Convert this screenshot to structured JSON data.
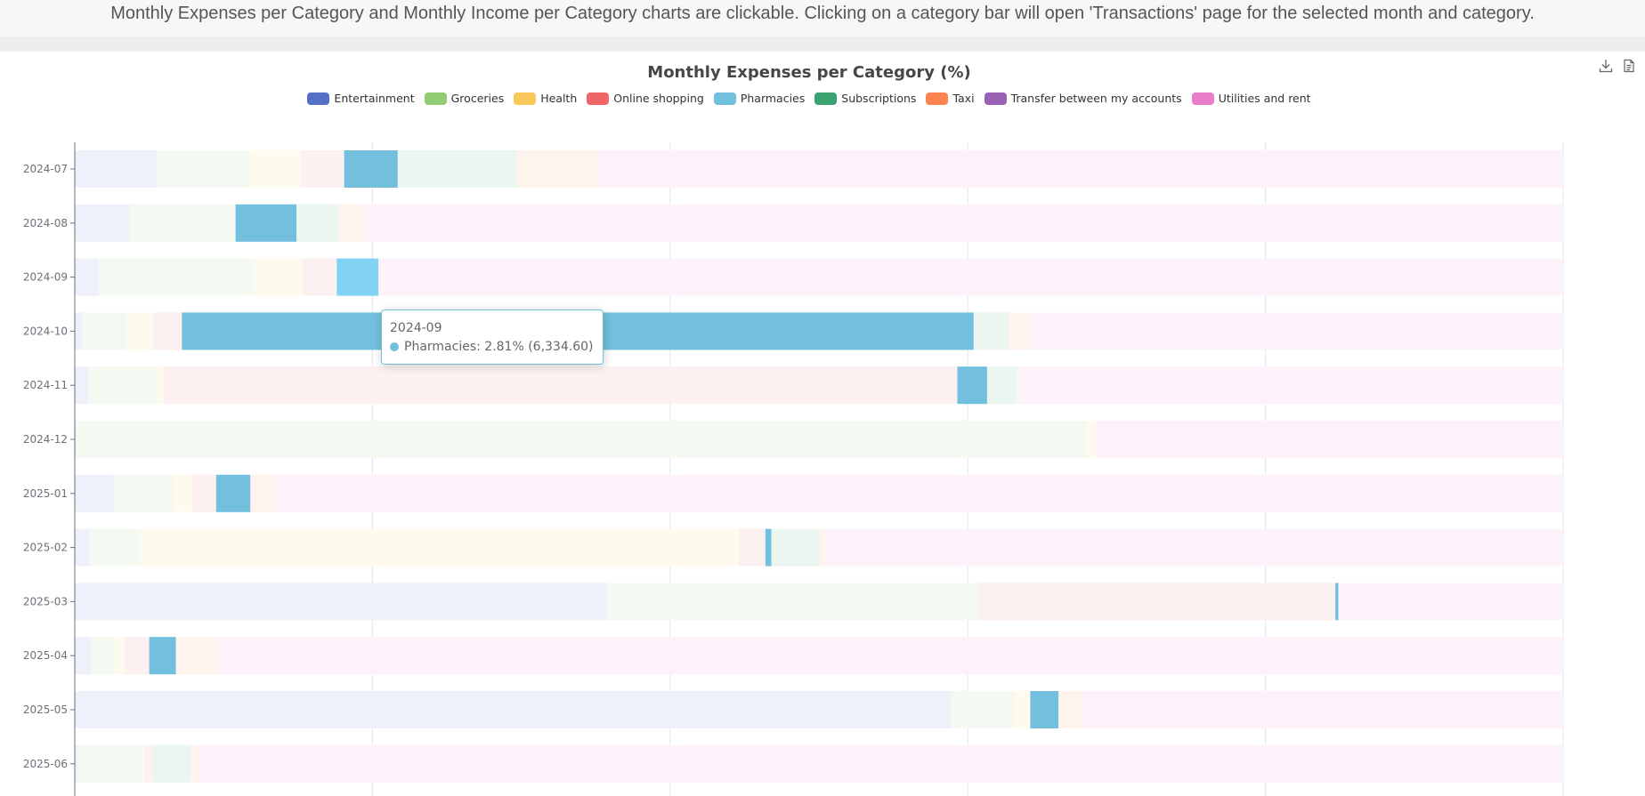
{
  "banner": {
    "text": "Monthly Expenses per Category and Monthly Income per Category charts are clickable. Clicking on a category bar will open 'Transactions' page for the selected month and category."
  },
  "toolbox": {
    "save_icon": "download-icon",
    "data_view_icon": "data-view-icon"
  },
  "tooltip": {
    "title": "2024-09",
    "series": "Pharmacies",
    "text": "Pharmacies: 2.81% (6,334.60)",
    "color": "#73c0de"
  },
  "chart_data": {
    "type": "bar",
    "orientation": "horizontal",
    "stacked": true,
    "title": "Monthly Expenses per Category (%)",
    "legend_position": "top-center",
    "grid": true,
    "xlim": [
      0,
      100
    ],
    "categories": [
      "2024-07",
      "2024-08",
      "2024-09",
      "2024-10",
      "2024-11",
      "2024-12",
      "2025-01",
      "2025-02",
      "2025-03",
      "2025-04",
      "2025-05",
      "2025-06"
    ],
    "highlighted_series": "Pharmacies",
    "highlighted_category": "2024-09",
    "series": [
      {
        "name": "Entertainment",
        "color": "#5470c6",
        "values": [
          5.5,
          3.7,
          1.6,
          0.5,
          0.9,
          0.1,
          2.6,
          1.0,
          35.7,
          1.1,
          58.9,
          0.2
        ]
      },
      {
        "name": "Groceries",
        "color": "#91cc75",
        "values": [
          6.3,
          7.1,
          10.5,
          3.0,
          4.7,
          67.9,
          4.0,
          3.4,
          25.0,
          1.6,
          4.2,
          4.4
        ]
      },
      {
        "name": "Health",
        "color": "#fac858",
        "values": [
          3.4,
          0.0,
          3.2,
          1.8,
          0.4,
          0.6,
          1.3,
          40.2,
          0.0,
          0.6,
          1.1,
          0.1
        ]
      },
      {
        "name": "Online shopping",
        "color": "#ee6666",
        "values": [
          2.9,
          0.0,
          2.3,
          1.9,
          53.3,
          0.0,
          1.6,
          1.8,
          24.0,
          1.7,
          0.0,
          0.5
        ]
      },
      {
        "name": "Pharmacies",
        "color": "#73c0de",
        "values": [
          3.6,
          4.1,
          2.81,
          53.2,
          2.0,
          0.0,
          2.3,
          0.4,
          0.2,
          1.8,
          1.9,
          0.0
        ]
      },
      {
        "name": "Subscriptions",
        "color": "#3ba272",
        "values": [
          8.0,
          2.9,
          0.0,
          2.4,
          2.0,
          0.0,
          0.0,
          3.3,
          0.0,
          0.0,
          0.0,
          2.6
        ]
      },
      {
        "name": "Taxi",
        "color": "#fc8452",
        "values": [
          5.4,
          1.8,
          0.0,
          1.5,
          0.0,
          0.0,
          1.5,
          0.4,
          0.0,
          2.8,
          1.6,
          0.6
        ]
      },
      {
        "name": "Transfer between my accounts",
        "color": "#9a60b4",
        "values": [
          0,
          0,
          0,
          0,
          0,
          0,
          0,
          0,
          0,
          0,
          0,
          0
        ]
      },
      {
        "name": "Utilities and rent",
        "color": "#ea7ccc",
        "values": [
          64.9,
          80.4,
          79.59,
          35.7,
          36.7,
          31.4,
          86.7,
          49.5,
          15.1,
          90.4,
          32.3,
          91.6
        ]
      }
    ]
  }
}
